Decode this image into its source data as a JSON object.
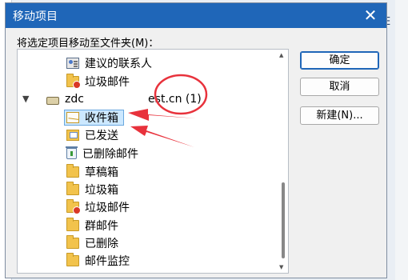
{
  "background": {
    "right_fragment": "E"
  },
  "dialog": {
    "title": "移动项目",
    "close_glyph": "✕",
    "instruction": "将选定项目移动至文件夹(M)：",
    "buttons": {
      "ok": "确定",
      "cancel": "取消",
      "new": "新建(N)..."
    }
  },
  "tree": {
    "items": [
      {
        "label": "建议的联系人",
        "icon": "contacts-icon"
      },
      {
        "label": "垃圾邮件",
        "icon": "junk-folder-icon"
      },
      {
        "label_start": "zdc",
        "label_redacted": "                  ",
        "label_end": "est.cn (1)",
        "icon": "account-icon",
        "expanded": true
      },
      {
        "label": "收件箱",
        "icon": "inbox-icon",
        "selected": true
      },
      {
        "label": "已发送",
        "icon": "sent-icon"
      },
      {
        "label": "已删除邮件",
        "icon": "deleted-icon"
      },
      {
        "label": "草稿箱",
        "icon": "folder-icon"
      },
      {
        "label": "垃圾箱",
        "icon": "folder-icon"
      },
      {
        "label": "垃圾邮件",
        "icon": "junk-folder-icon"
      },
      {
        "label": "群邮件",
        "icon": "folder-icon"
      },
      {
        "label": "已删除",
        "icon": "folder-icon"
      },
      {
        "label": "邮件监控",
        "icon": "folder-icon"
      }
    ]
  },
  "annotations": {
    "color": "#e8323c"
  },
  "colors": {
    "titlebar": "#1f66b8",
    "selection": "#cce8ff",
    "folder": "#f2c34c"
  }
}
